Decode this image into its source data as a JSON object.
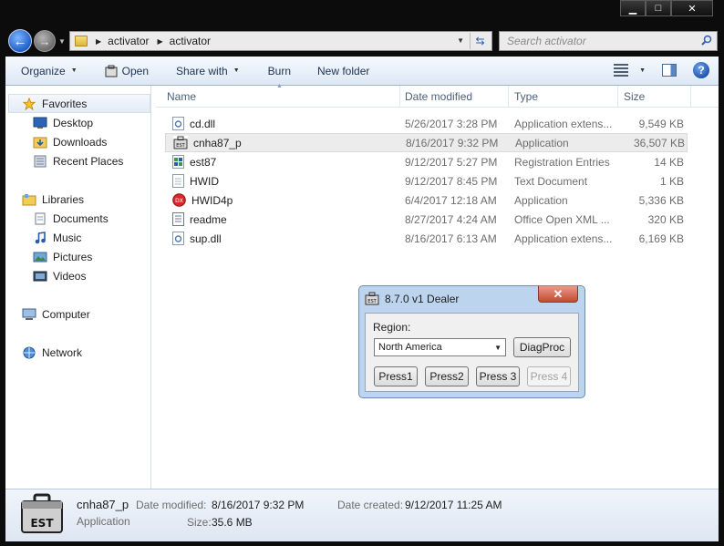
{
  "window": {
    "minimize_glyph": "▁",
    "maximize_glyph": "□",
    "close_glyph": "✕"
  },
  "address": {
    "crumbs": [
      "activator",
      "activator"
    ],
    "search_placeholder": "Search activator"
  },
  "toolbar": {
    "organize": "Organize",
    "open": "Open",
    "share_with": "Share with",
    "burn": "Burn",
    "new_folder": "New folder",
    "help": "?"
  },
  "sidebar": {
    "favorites": "Favorites",
    "desktop": "Desktop",
    "downloads": "Downloads",
    "recent_places": "Recent Places",
    "libraries": "Libraries",
    "documents": "Documents",
    "music": "Music",
    "pictures": "Pictures",
    "videos": "Videos",
    "computer": "Computer",
    "network": "Network"
  },
  "columns": {
    "name": "Name",
    "date_modified": "Date modified",
    "type": "Type",
    "size": "Size"
  },
  "files": [
    {
      "name": "cd.dll",
      "date": "5/26/2017 3:28 PM",
      "type": "Application extens...",
      "size": "9,549 KB",
      "icon": "dll-icon"
    },
    {
      "name": "cnha87_p",
      "date": "8/16/2017 9:32 PM",
      "type": "Application",
      "size": "36,507 KB",
      "icon": "toolcase-icon"
    },
    {
      "name": "est87",
      "date": "9/12/2017 5:27 PM",
      "type": "Registration Entries",
      "size": "14 KB",
      "icon": "registry-icon"
    },
    {
      "name": "HWID",
      "date": "9/12/2017 8:45 PM",
      "type": "Text Document",
      "size": "1 KB",
      "icon": "text-file-icon"
    },
    {
      "name": "HWID4p",
      "date": "6/4/2017 12:18 AM",
      "type": "Application",
      "size": "5,336 KB",
      "icon": "red-app-icon"
    },
    {
      "name": "readme",
      "date": "8/27/2017 4:24 AM",
      "type": "Office Open XML ...",
      "size": "320 KB",
      "icon": "document-icon"
    },
    {
      "name": "sup.dll",
      "date": "8/16/2017 6:13 AM",
      "type": "Application extens...",
      "size": "6,169 KB",
      "icon": "dll-icon"
    }
  ],
  "dialog": {
    "title": "8.7.0 v1 Dealer",
    "close_glyph": "✕",
    "region_label": "Region:",
    "region_value": "North America",
    "diagproc": "DiagProc",
    "press1": "Press1",
    "press2": "Press2",
    "press3": "Press 3",
    "press4": "Press 4"
  },
  "details": {
    "name": "cnha87_p",
    "type": "Application",
    "date_modified_label": "Date modified:",
    "date_modified": "8/16/2017 9:32 PM",
    "size_label": "Size:",
    "size": "35.6 MB",
    "date_created_label": "Date created:",
    "date_created": "9/12/2017 11:25 AM",
    "icon_text": "EST"
  }
}
